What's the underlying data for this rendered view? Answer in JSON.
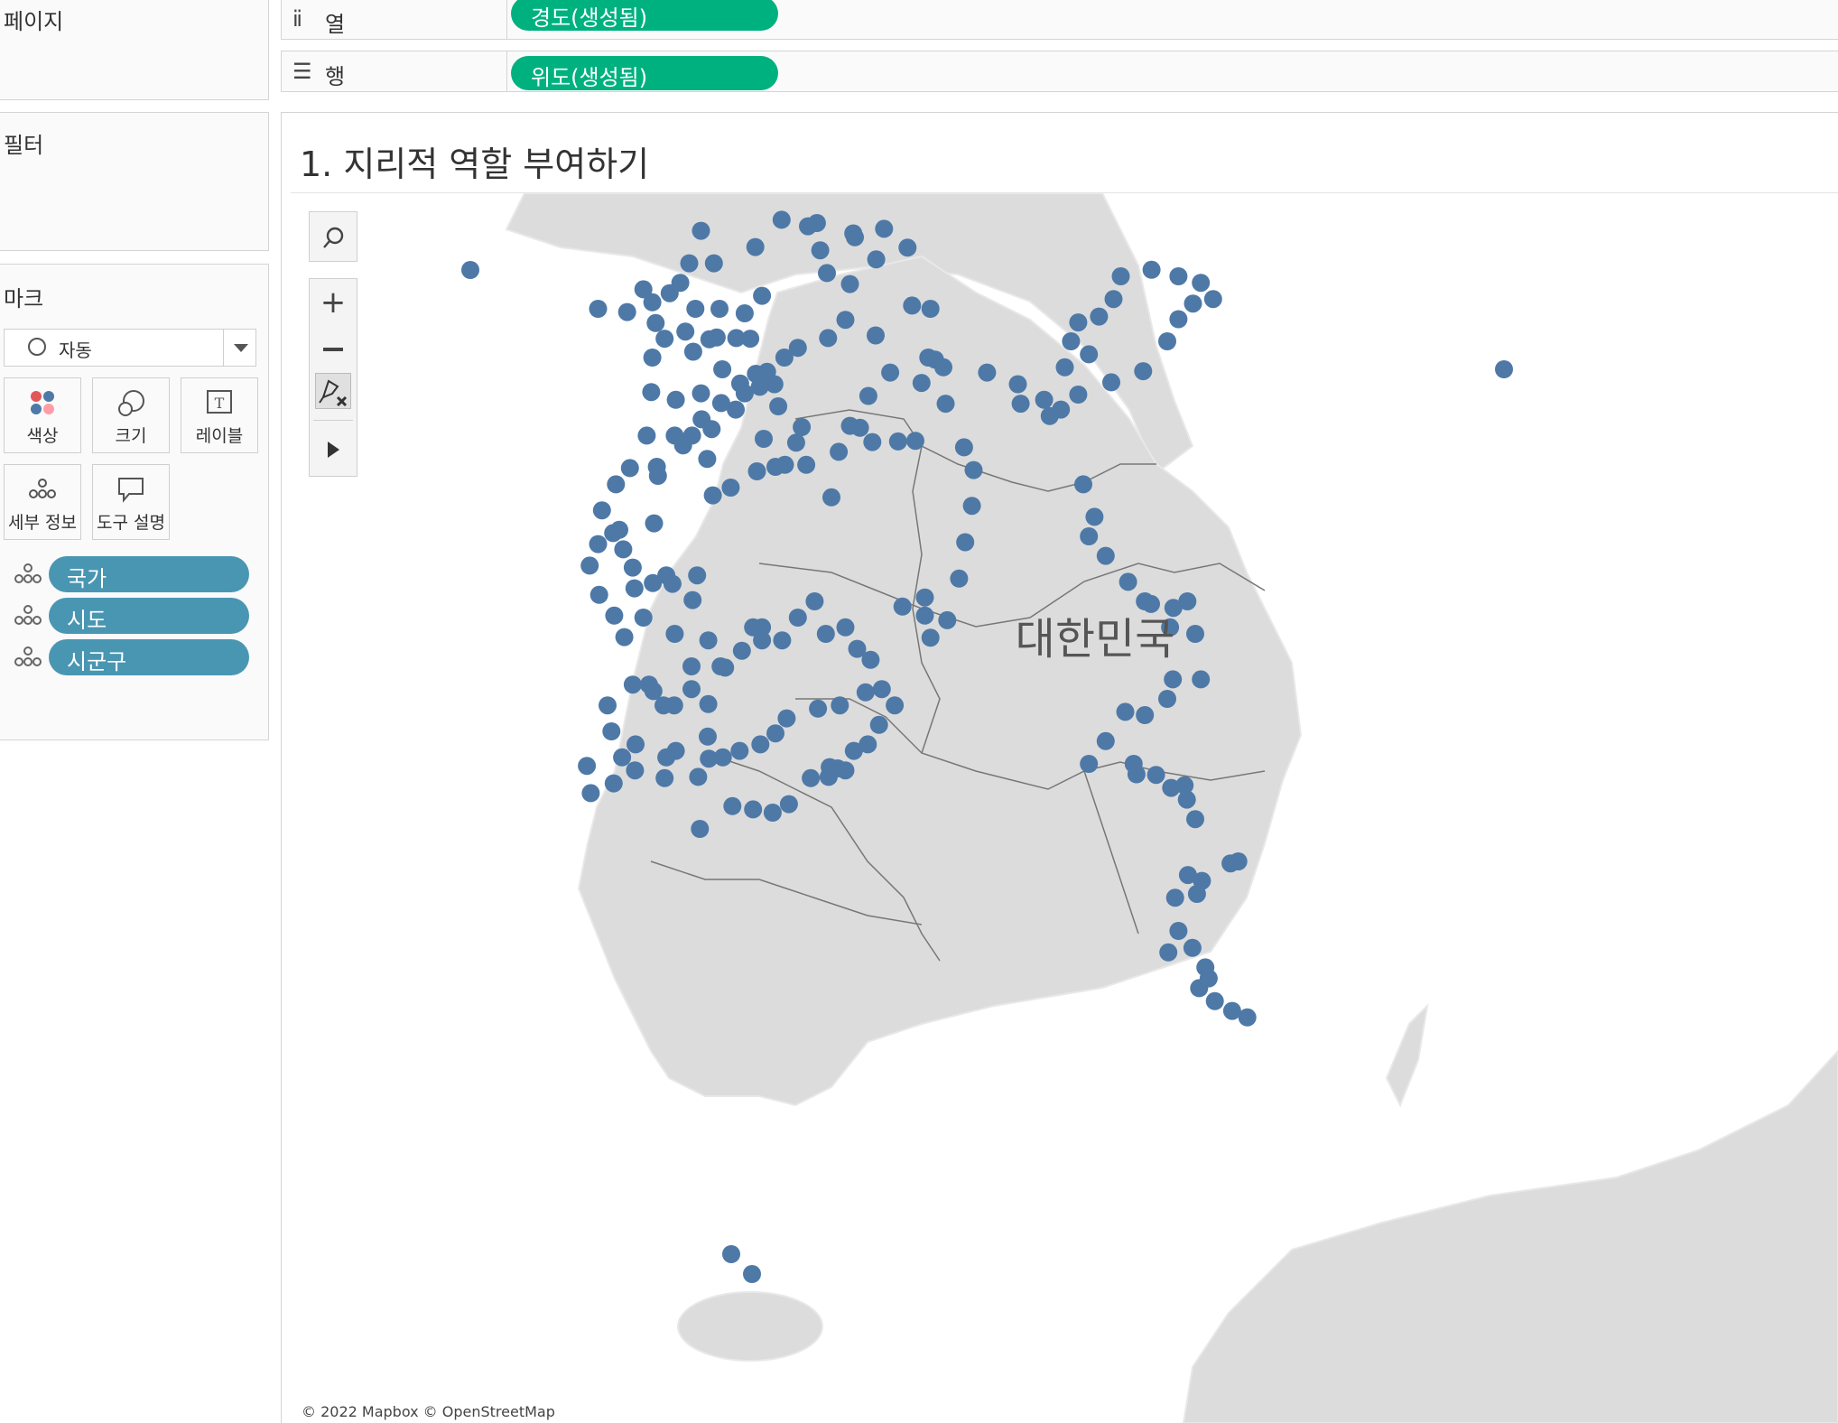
{
  "pages_panel": {
    "title": "페이지"
  },
  "filters_panel": {
    "title": "필터"
  },
  "marks_panel": {
    "title": "마크",
    "mark_type": "자동",
    "buttons": [
      {
        "label": "색상",
        "icon": "color-dots-icon"
      },
      {
        "label": "크기",
        "icon": "size-circles-icon"
      },
      {
        "label": "레이블",
        "icon": "label-T-icon"
      },
      {
        "label": "세부 정보",
        "icon": "detail-dots-icon"
      },
      {
        "label": "도구 설명",
        "icon": "tooltip-bubble-icon"
      }
    ],
    "fields": [
      {
        "label": "국가",
        "icon": "detail-dots-icon"
      },
      {
        "label": "시도",
        "icon": "detail-dots-icon"
      },
      {
        "label": "시군구",
        "icon": "detail-dots-icon"
      }
    ]
  },
  "columns_shelf": {
    "label": "열",
    "icon": "columns-icon",
    "pill": "경도(생성됨)"
  },
  "rows_shelf": {
    "label": "행",
    "icon": "rows-icon",
    "pill": "위도(생성됨)"
  },
  "worksheet": {
    "title": "1. 지리적 역할 부여하기"
  },
  "map": {
    "country_label": "대한민국",
    "attribution": "© 2022 Mapbox © OpenStreetMap",
    "controls": [
      "search-icon",
      "zoom-in-icon",
      "zoom-out-icon",
      "pin-map-icon",
      "expand-arrow-icon"
    ],
    "mark_color": "#4e79a7"
  },
  "colors": {
    "pill_dimension": "#4996b2",
    "pill_generated": "#00b180"
  }
}
